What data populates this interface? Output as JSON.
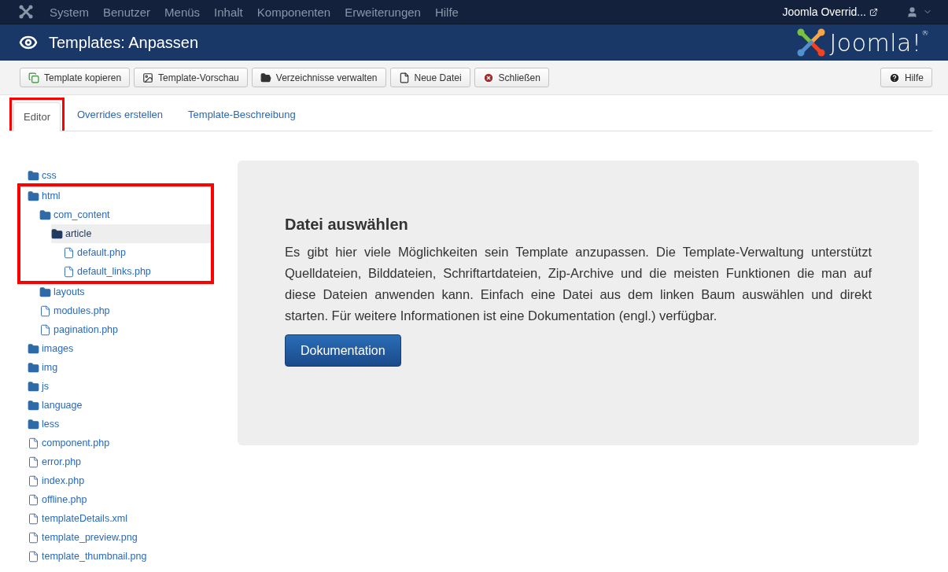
{
  "top_menu": {
    "items": [
      "System",
      "Benutzer",
      "Menüs",
      "Inhalt",
      "Komponenten",
      "Erweiterungen",
      "Hilfe"
    ],
    "site_link": "Joomla Overrid..."
  },
  "header": {
    "title": "Templates: Anpassen",
    "logo_text": "Joomla!$^{®}$"
  },
  "toolbar": {
    "buttons": [
      {
        "label": "Template kopieren",
        "kind": "copy"
      },
      {
        "label": "Template-Vorschau",
        "kind": "preview"
      },
      {
        "label": "Verzeichnisse verwalten",
        "kind": "folders"
      },
      {
        "label": "Neue Datei",
        "kind": "file"
      },
      {
        "label": "Schließen",
        "kind": "close"
      }
    ],
    "help": "Hilfe"
  },
  "tabs": [
    {
      "label": "Editor",
      "selected": true,
      "outlined": true
    },
    {
      "label": "Overrides erstellen",
      "selected": false,
      "outlined": false
    },
    {
      "label": "Template-Beschreibung",
      "selected": false,
      "outlined": false
    }
  ],
  "tree": [
    {
      "label": "css",
      "kind": "folder",
      "selected": false,
      "outlined": false
    },
    {
      "label": "html",
      "kind": "folder",
      "selected": false,
      "outlined": true,
      "children": [
        {
          "label": "com_content",
          "kind": "folder",
          "selected": false,
          "outlined": true,
          "children": [
            {
              "label": "article",
              "kind": "folder",
              "selected": true,
              "outlined": true,
              "children": [
                {
                  "label": "default.php",
                  "kind": "file",
                  "selected": false,
                  "outlined": true
                },
                {
                  "label": "default_links.php",
                  "kind": "file",
                  "selected": false,
                  "outlined": true
                }
              ]
            }
          ]
        },
        {
          "label": "layouts",
          "kind": "folder",
          "selected": false,
          "outlined": false
        },
        {
          "label": "modules.php",
          "kind": "file",
          "selected": false,
          "outlined": false
        },
        {
          "label": "pagination.php",
          "kind": "file",
          "selected": false,
          "outlined": false
        }
      ]
    },
    {
      "label": "images",
      "kind": "folder",
      "selected": false,
      "outlined": false
    },
    {
      "label": "img",
      "kind": "folder",
      "selected": false,
      "outlined": false
    },
    {
      "label": "js",
      "kind": "folder",
      "selected": false,
      "outlined": false
    },
    {
      "label": "language",
      "kind": "folder",
      "selected": false,
      "outlined": false
    },
    {
      "label": "less",
      "kind": "folder",
      "selected": false,
      "outlined": false
    },
    {
      "label": "component.php",
      "kind": "file",
      "selected": false,
      "outlined": false
    },
    {
      "label": "error.php",
      "kind": "file",
      "selected": false,
      "outlined": false
    },
    {
      "label": "index.php",
      "kind": "file",
      "selected": false,
      "outlined": false
    },
    {
      "label": "offline.php",
      "kind": "file",
      "selected": false,
      "outlined": false
    },
    {
      "label": "templateDetails.xml",
      "kind": "file",
      "selected": false,
      "outlined": false
    },
    {
      "label": "template_preview.png",
      "kind": "file",
      "selected": false,
      "outlined": false
    },
    {
      "label": "template_thumbnail.png",
      "kind": "file",
      "selected": false,
      "outlined": false
    }
  ],
  "info_panel": {
    "title": "Datei auswählen",
    "text": "Es gibt hier viele Möglichkeiten sein Template anzupassen. Die Template-Verwaltung unterstützt Quelldateien, Bilddateien, Schriftartdateien, Zip-Archive und die meisten Funktionen die man auf diese Dateien anwenden kann. Einfach eine Datei aus dem linken Baum auswählen und direkt starten. Für weitere Informationen ist eine Dokumentation (engl.) verfügbar.",
    "button": "Dokumentation"
  }
}
